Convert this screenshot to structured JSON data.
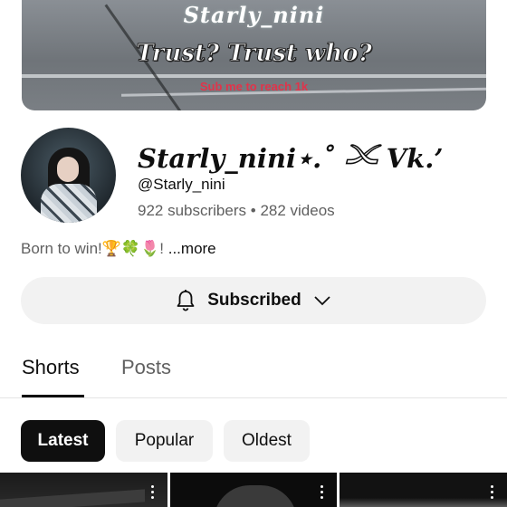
{
  "banner": {
    "title_script": "Starly_nini",
    "headline": "Trust? Trust who?",
    "cta": "Sub me to reach 1k"
  },
  "channel": {
    "name": "Starly_nini⋆.˚ 𓄌 Vk.’",
    "handle": "@Starly_nini",
    "subscribers": "922 subscribers",
    "separator": "•",
    "videos": "282 videos",
    "bio": "Born to win!🏆🍀🌷!",
    "bio_more": "...more"
  },
  "subscribe_button": {
    "label": "Subscribed",
    "icon": "bell-icon",
    "dropdown_icon": "chevron-down-icon"
  },
  "tabs": [
    {
      "label": "Shorts",
      "active": true
    },
    {
      "label": "Posts",
      "active": false
    }
  ],
  "filters": [
    {
      "label": "Latest",
      "selected": true
    },
    {
      "label": "Popular",
      "selected": false
    },
    {
      "label": "Oldest",
      "selected": false
    }
  ],
  "colors": {
    "text_primary": "#0f0f0f",
    "text_secondary": "#606060",
    "chip_background": "#f2f2f2",
    "chip_selected": "#0f0f0f",
    "banner_cta": "#e0344b"
  }
}
